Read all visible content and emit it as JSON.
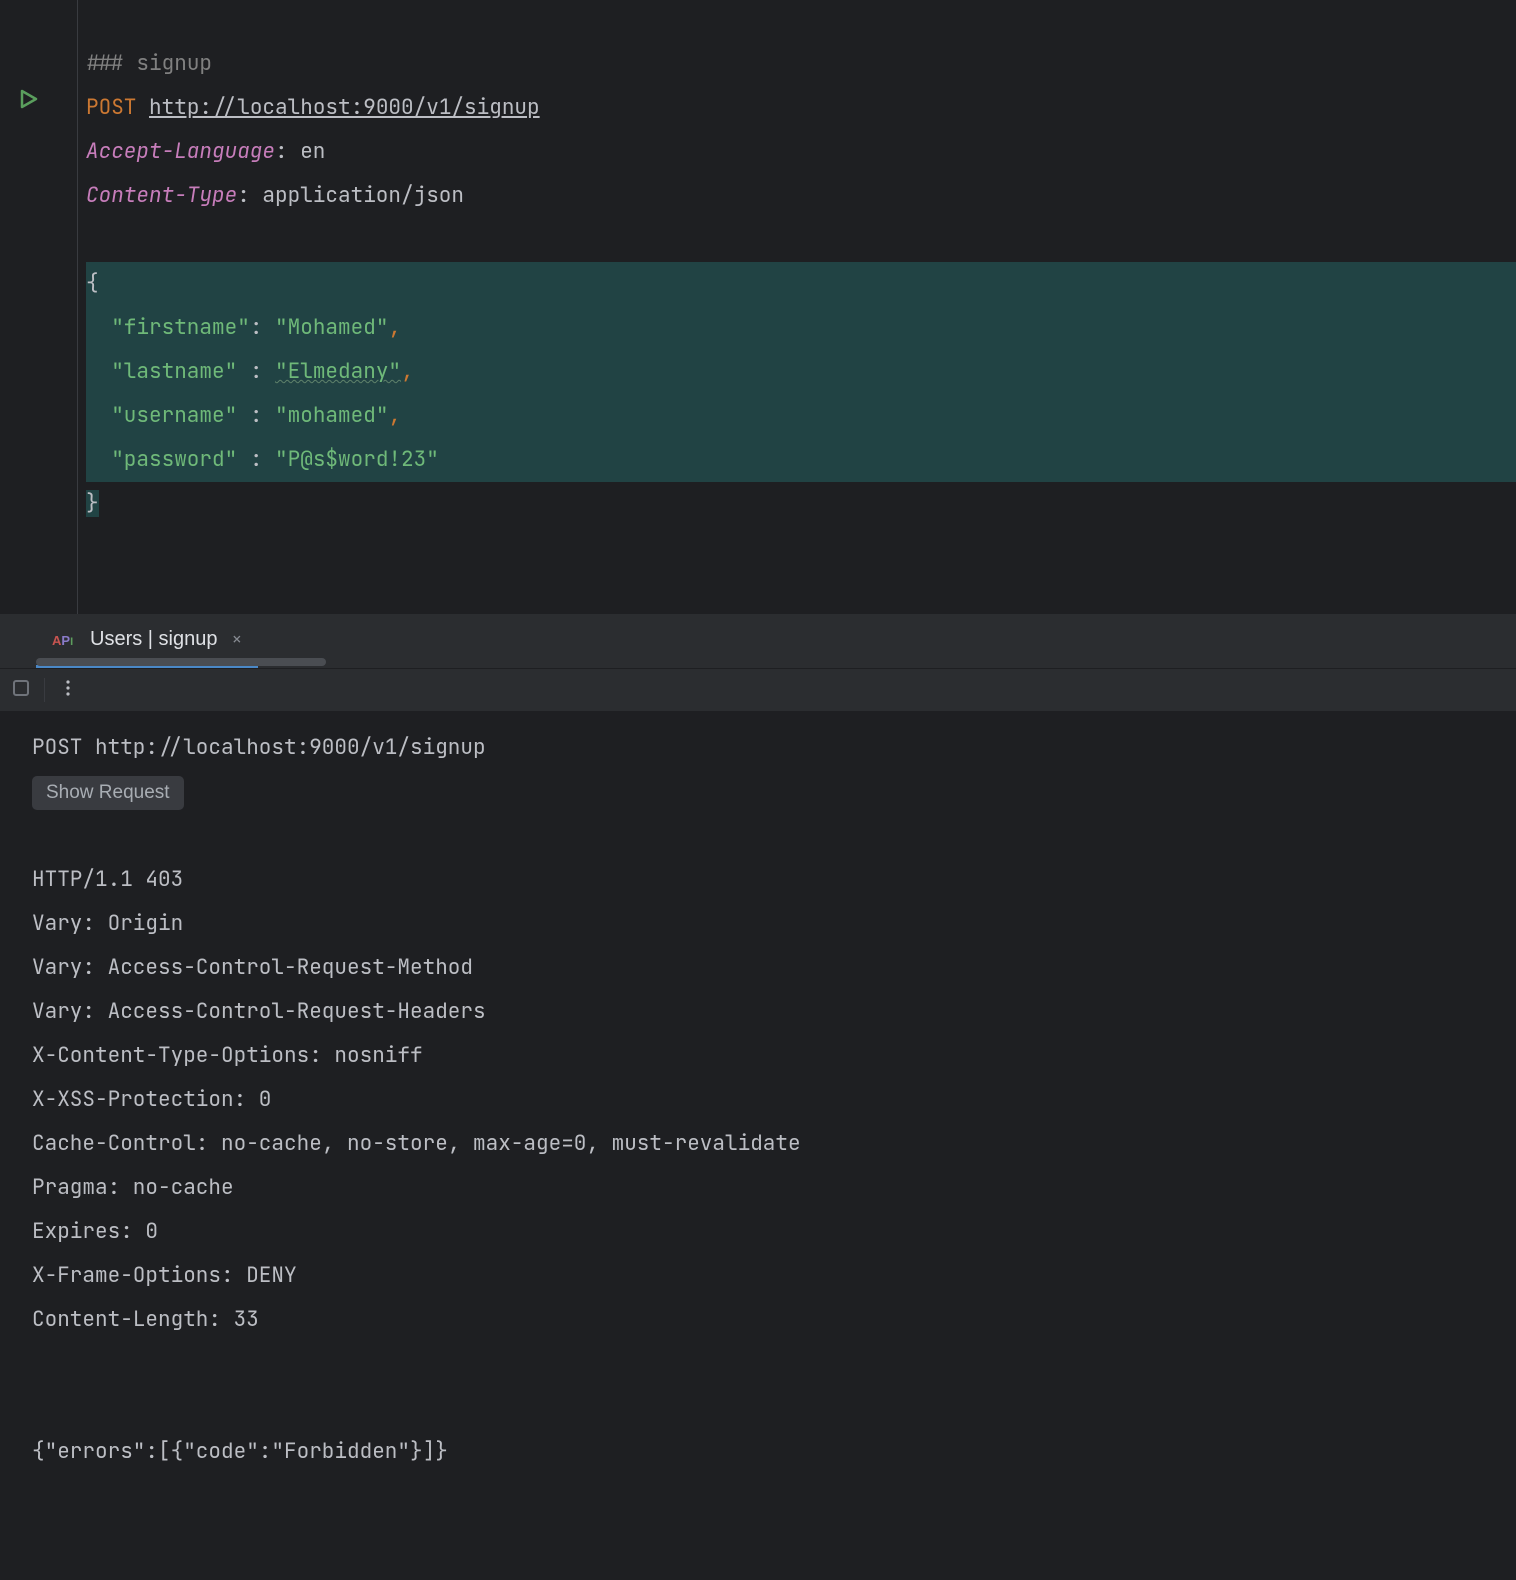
{
  "editor": {
    "section_marker": "###",
    "section_name": "signup",
    "method": "POST",
    "url": "http://localhost:9000/v1/signup",
    "headers": [
      {
        "name": "Accept-Language",
        "value": "en"
      },
      {
        "name": "Content-Type",
        "value": "application/json"
      }
    ],
    "body": {
      "open_brace": "{",
      "fields": [
        {
          "key": "\"firstname\"",
          "align": "",
          "value": "\"Mohamed\"",
          "comma": ",",
          "underline": false
        },
        {
          "key": "\"lastname\"",
          "align": " ",
          "value": "\"Elmedany\"",
          "comma": ",",
          "underline": true
        },
        {
          "key": "\"username\"",
          "align": " ",
          "value": "\"mohamed\"",
          "comma": ",",
          "underline": false
        },
        {
          "key": "\"password\"",
          "align": " ",
          "value": "\"P@s$word!23\"",
          "comma": "",
          "underline": false
        }
      ],
      "close_brace": "}"
    }
  },
  "tab": {
    "title": "Users | signup",
    "close": "×"
  },
  "response": {
    "request_line": "POST http://localhost:9000/v1/signup",
    "show_request_label": "Show Request",
    "status_line": "HTTP/1.1 403",
    "headers": [
      "Vary: Origin",
      "Vary: Access-Control-Request-Method",
      "Vary: Access-Control-Request-Headers",
      "X-Content-Type-Options: nosniff",
      "X-XSS-Protection: 0",
      "Cache-Control: no-cache, no-store, max-age=0, must-revalidate",
      "Pragma: no-cache",
      "Expires: 0",
      "X-Frame-Options: DENY",
      "Content-Length: 33"
    ],
    "body": "{\"errors\":[{\"code\":\"Forbidden\"}]}"
  }
}
